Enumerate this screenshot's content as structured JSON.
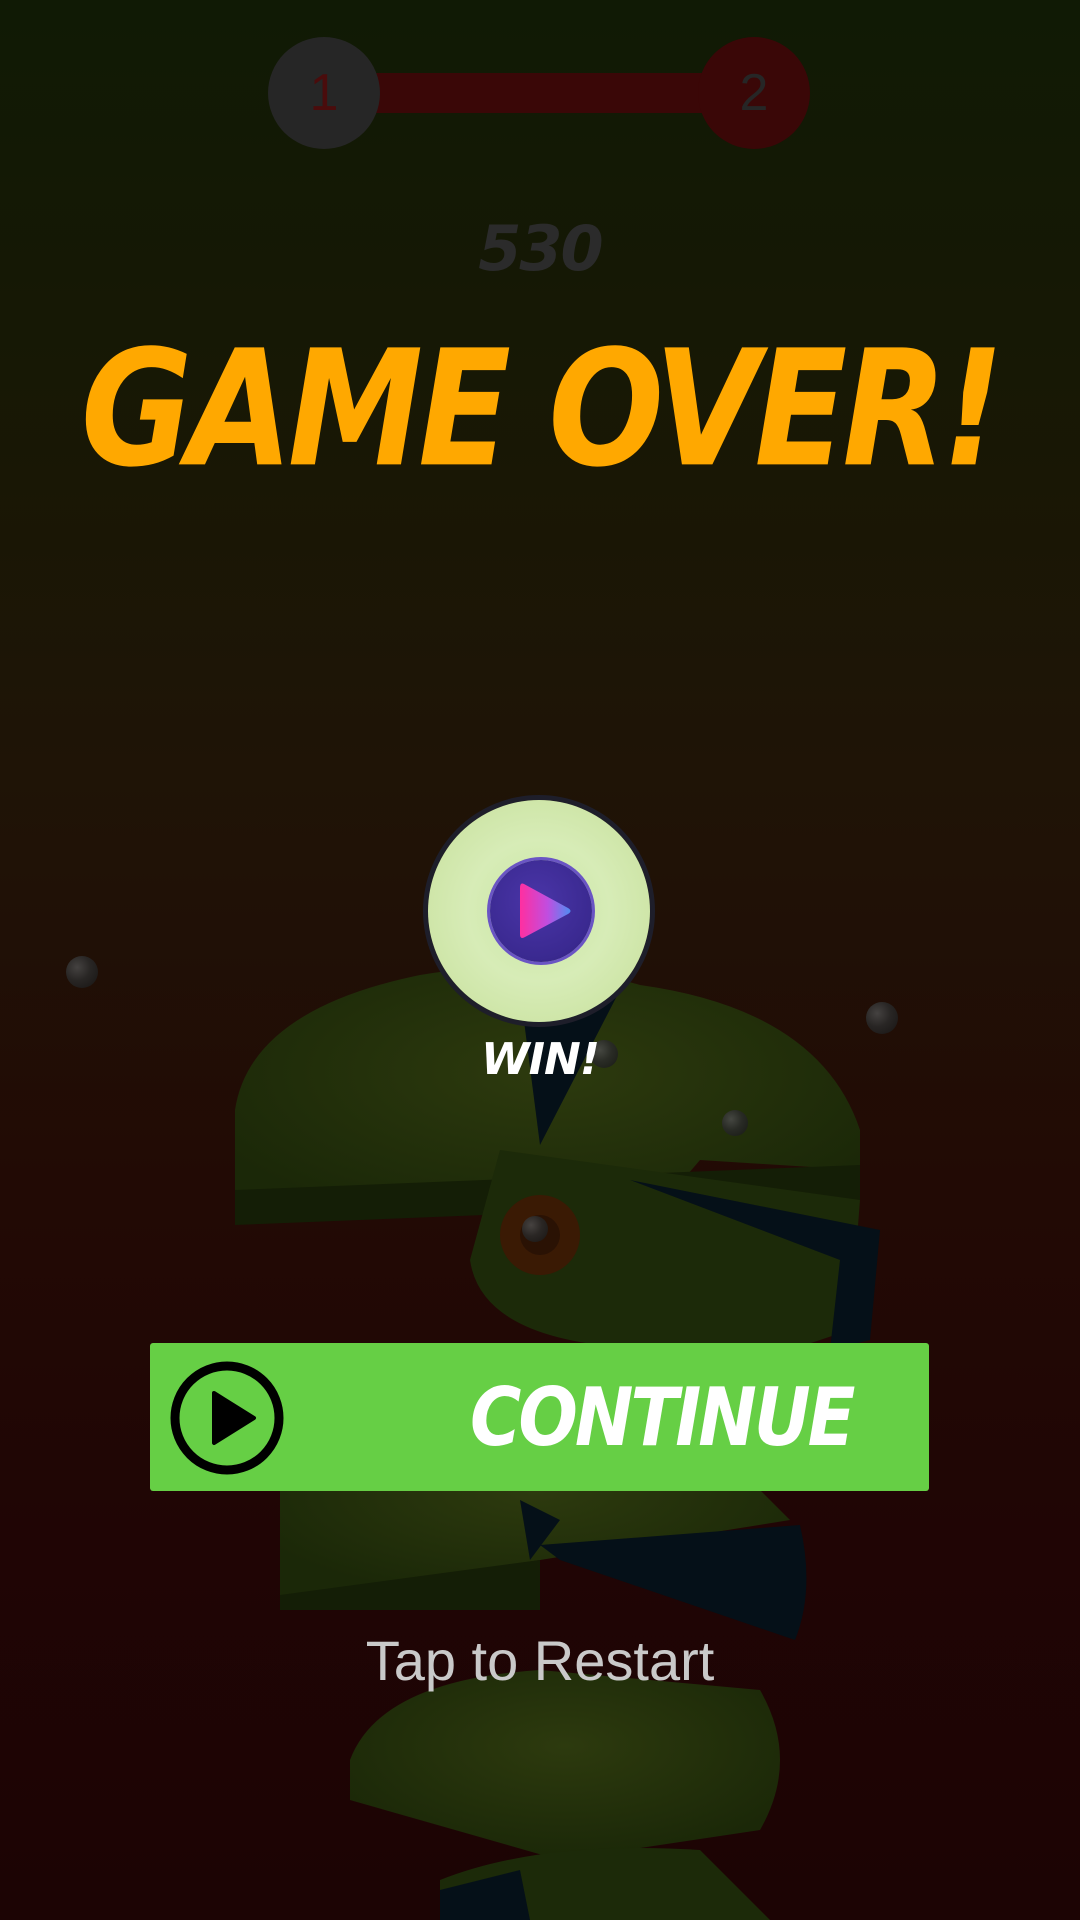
{
  "level": {
    "current": "1",
    "next": "2"
  },
  "score": "530",
  "title": "GAME OVER!",
  "reward": {
    "label": "WIN!"
  },
  "continue_button": {
    "label": "CONTINUE"
  },
  "restart": {
    "label": "Tap to Restart"
  },
  "colors": {
    "title": "#ffa800",
    "continue_button": "#66cf45",
    "reward_badge": "#d7ecb7",
    "reward_play": "#3a2990"
  },
  "icons": {
    "reward": "play-icon",
    "continue": "play-circle-icon"
  }
}
